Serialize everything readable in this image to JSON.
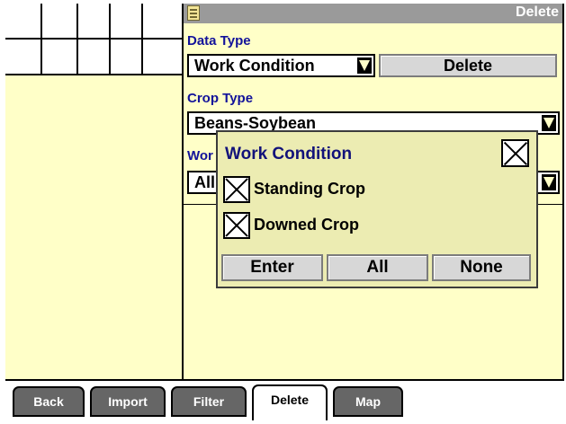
{
  "window": {
    "title": "Delete"
  },
  "data_type": {
    "label": "Data Type",
    "value": "Work Condition",
    "delete_button": "Delete"
  },
  "crop_type": {
    "label": "Crop Type",
    "value": "Beans-Soybean"
  },
  "work_condition_field": {
    "label": "Wor",
    "value": "All"
  },
  "popup": {
    "title": "Work Condition",
    "options": [
      {
        "label": "Standing Crop",
        "checked": true
      },
      {
        "label": "Downed Crop",
        "checked": true
      }
    ],
    "buttons": {
      "enter": "Enter",
      "all": "All",
      "none": "None"
    }
  },
  "tabs": [
    {
      "label": "Back",
      "active": false
    },
    {
      "label": "Import",
      "active": false
    },
    {
      "label": "Filter",
      "active": false
    },
    {
      "label": "Delete",
      "active": true
    },
    {
      "label": "Map",
      "active": false
    }
  ],
  "colors": {
    "panel_bg": "#ffffc8",
    "title_bar": "#9a9a9a",
    "label_text": "#12129a",
    "tab_bg": "#666666"
  }
}
